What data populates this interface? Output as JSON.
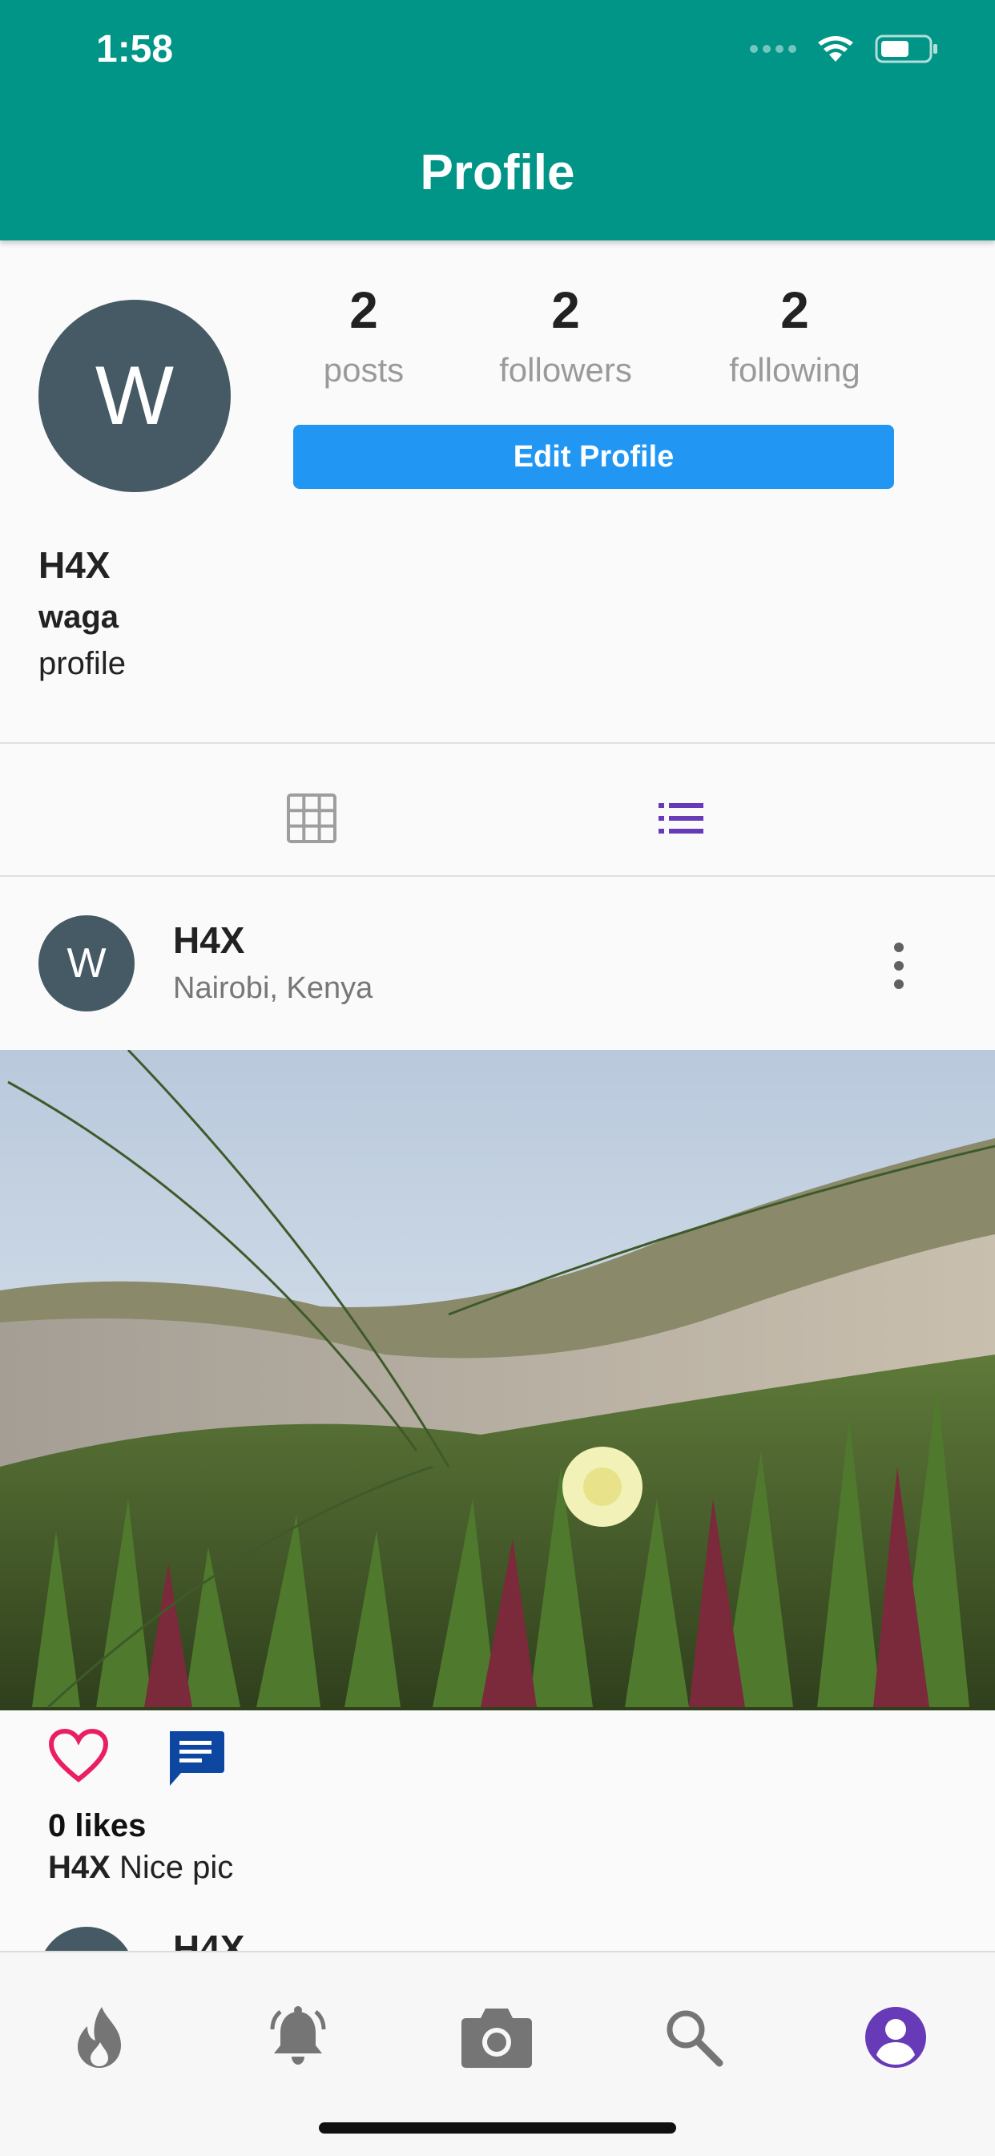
{
  "status_bar": {
    "time": "1:58"
  },
  "header": {
    "title": "Profile"
  },
  "profile": {
    "avatar_initial": "W",
    "stats": [
      {
        "value": "2",
        "label": "posts"
      },
      {
        "value": "2",
        "label": "followers"
      },
      {
        "value": "2",
        "label": "following"
      }
    ],
    "edit_button_label": "Edit Profile",
    "display_name": "H4X",
    "username": "waga",
    "bio": "profile"
  },
  "view_toggle": {
    "active": "list",
    "accent_color": "#673ab7",
    "inactive_color": "#9e9e9e"
  },
  "post": {
    "avatar_initial": "W",
    "user": "H4X",
    "location": "Nairobi, Kenya",
    "likes_text": "0 likes",
    "caption_user": "H4X",
    "caption_text": "Nice pic"
  },
  "next_post": {
    "user": "H4X"
  },
  "bottom_nav": {
    "items": [
      "fire-icon",
      "bell-icon",
      "camera-icon",
      "search-icon",
      "account-icon"
    ],
    "active": "account-icon",
    "active_color": "#673ab7",
    "inactive_color": "#757575"
  },
  "colors": {
    "header": "#019587",
    "edit_button": "#2196f3",
    "avatar": "#455a64",
    "like": "#e91e63",
    "comment": "#0d47a1"
  }
}
